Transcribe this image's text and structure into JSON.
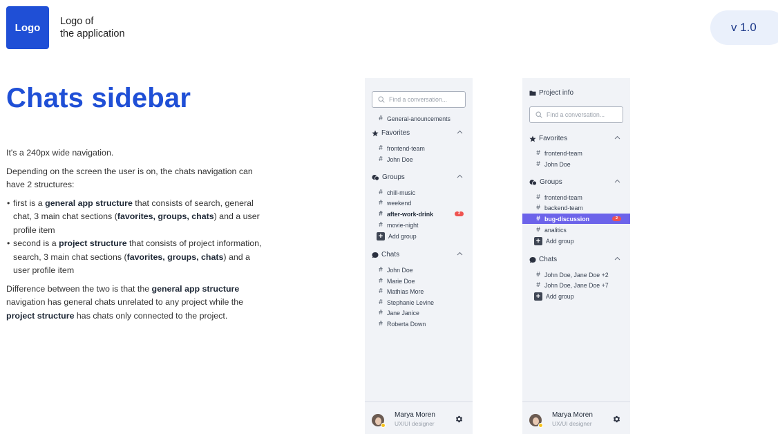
{
  "logo": {
    "label": "Logo",
    "caption_line1": "Logo of",
    "caption_line2": "the application"
  },
  "version": "v 1.0",
  "title": "Chats sidebar",
  "description": {
    "p1": "It's a 240px wide navigation.",
    "p2": "Depending on the screen the user is on, the chats navigation can have 2 structures:",
    "b1": {
      "t1": "first is a ",
      "b1": "general app structure",
      "t2": " that consists of search, general chat, 3 main chat sections (",
      "b2": "favorites, groups, chats",
      "t3": ") and a user profile item"
    },
    "b2": {
      "t1": "second is a ",
      "b1": "project structure",
      "t2": " that consists of project information, search, 3 main chat sections (",
      "b2": "favorites, groups, chats",
      "t3": ") and a user profile item"
    },
    "p3": {
      "t1": "Difference between the two is that the ",
      "b1": "general app structure",
      "t2": " navigation has general chats unrelated to any project while the ",
      "b2": "project structure",
      "t3": " has chats only connected to the project."
    }
  },
  "colors": {
    "brand": "#1f4fd6",
    "selected": "#6c63ea",
    "badge": "#ef5350",
    "panel_bg": "#f1f3f7"
  },
  "sidebar_general": {
    "search_placeholder": "Find a conversation...",
    "general_chat": "General-anouncements",
    "favorites": {
      "title": "Favorites",
      "items": [
        "frontend-team",
        "John Doe"
      ]
    },
    "groups": {
      "title": "Groups",
      "items": [
        "chill-music",
        "weekend",
        "after-work-drink",
        "movie-night"
      ],
      "bold_item_badge": "2",
      "add_label": "Add group"
    },
    "chats": {
      "title": "Chats",
      "items": [
        "John Doe",
        "Marie Doe",
        "Mathias More",
        "Stephanie Levine",
        "Jane Janice",
        "Roberta Down"
      ]
    },
    "user": {
      "name": "Marya Moren",
      "role": "UX/UI designer"
    }
  },
  "sidebar_project": {
    "project_info": "Project info",
    "search_placeholder": "Find a conversation...",
    "favorites": {
      "title": "Favorites",
      "items": [
        "frontend-team",
        "John Doe"
      ]
    },
    "groups": {
      "title": "Groups",
      "items": [
        "frontend-team",
        "backend-team",
        "bug-discussion",
        "analitics"
      ],
      "selected_badge": "2",
      "add_label": "Add group"
    },
    "chats": {
      "title": "Chats",
      "items": [
        "John Doe, Jane Doe +2",
        "John Doe, Jane Doe +7"
      ],
      "add_label": "Add group"
    },
    "user": {
      "name": "Marya Moren",
      "role": "UX/UI designer"
    }
  }
}
